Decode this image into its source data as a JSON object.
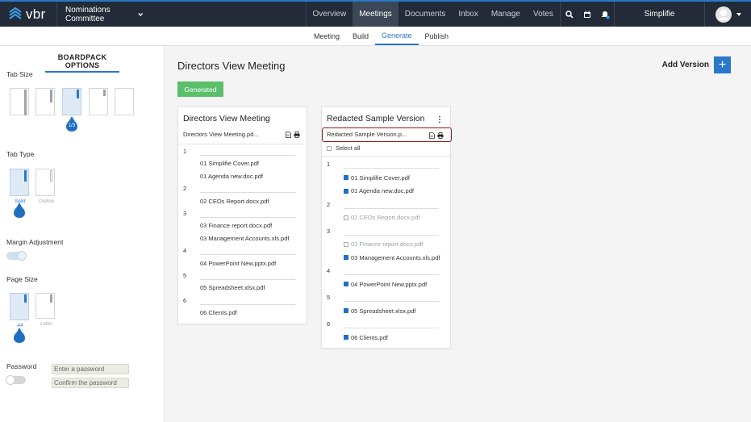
{
  "topbar": {
    "logo_text": "vbr",
    "committee": "Nominations Committee",
    "nav": [
      "Overview",
      "Meetings",
      "Documents",
      "Inbox",
      "Manage",
      "Votes"
    ],
    "active_nav": "Meetings",
    "user": "Simplifie"
  },
  "subnav": {
    "items": [
      "Meeting",
      "Build",
      "Generate",
      "Publish"
    ],
    "active": "Generate"
  },
  "sidebar": {
    "title": "BOARDPACK OPTIONS",
    "tab_size_label": "Tab Size",
    "tab_size_badge": "1/3",
    "tab_type_label": "Tab Type",
    "tab_type_options": [
      "Solid",
      "Outline"
    ],
    "margin_label": "Margin Adjustment",
    "margin_on": true,
    "page_size_label": "Page Size",
    "page_size_options": [
      "A4",
      "Letter"
    ],
    "password_label": "Password",
    "password_on": false,
    "password_placeholder": "Enter a password",
    "confirm_placeholder": "Confirm the password"
  },
  "main": {
    "title": "Directors View Meeting",
    "add_version": "Add Version",
    "status": "Generated"
  },
  "cards": [
    {
      "title": "Directors View Meeting",
      "file": "Directors View Meeting.pd...",
      "sections": [
        {
          "num": "1",
          "docs": [
            "01 Simplifie Cover.pdf",
            "01 Agenda new.doc.pdf"
          ]
        },
        {
          "num": "2",
          "docs": [
            "02 CEOs Report.docx.pdf"
          ]
        },
        {
          "num": "3",
          "docs": [
            "03 Finance report.docx.pdf",
            "03 Management Accounts.xls.pdf"
          ]
        },
        {
          "num": "4",
          "docs": [
            "04 PowerPoint New.pptx.pdf"
          ]
        },
        {
          "num": "5",
          "docs": [
            "05 Spreadsheet.xlsx.pdf"
          ]
        },
        {
          "num": "6",
          "docs": [
            "06 Clients.pdf"
          ]
        }
      ]
    },
    {
      "title": "Redacted Sample Version",
      "file": "Redacted Sample Version.p...",
      "select_all": "Select all",
      "sections": [
        {
          "num": "1",
          "docs": [
            {
              "name": "01 Simplifie Cover.pdf",
              "on": true
            },
            {
              "name": "01 Agenda new.doc.pdf",
              "on": true
            }
          ]
        },
        {
          "num": "2",
          "docs": [
            {
              "name": "02 CEOs Report.docx.pdf",
              "on": false
            }
          ]
        },
        {
          "num": "3",
          "docs": [
            {
              "name": "03 Finance report.docx.pdf",
              "on": false
            },
            {
              "name": "03 Management Accounts.xls.pdf",
              "on": true
            }
          ]
        },
        {
          "num": "4",
          "docs": [
            {
              "name": "04 PowerPoint New.pptx.pdf",
              "on": true
            }
          ]
        },
        {
          "num": "5",
          "docs": [
            {
              "name": "05 Spreadsheet.xlsx.pdf",
              "on": true
            }
          ]
        },
        {
          "num": "6",
          "docs": [
            {
              "name": "06 Clients.pdf",
              "on": true
            }
          ]
        }
      ]
    }
  ],
  "colors": {
    "accent": "#2a78c8",
    "topbar": "#222b37",
    "success": "#5bbf6a",
    "redact_border": "#8c1b1b"
  }
}
